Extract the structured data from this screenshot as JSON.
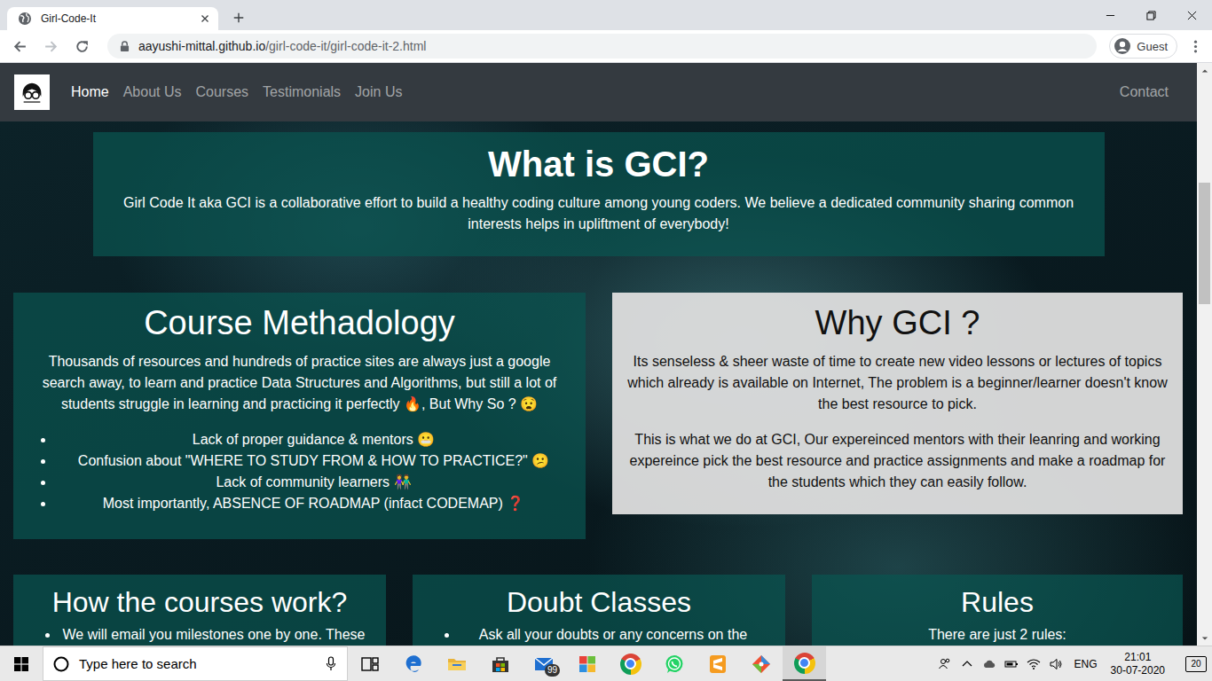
{
  "tabs": [
    {
      "label": "Girl-Code-It",
      "selected": true
    }
  ],
  "address_bar": {
    "host": "aayushi-mittal.github.io",
    "path": "/girl-code-it/girl-code-it-2.html"
  },
  "profile": {
    "label": "Guest"
  },
  "navbar": {
    "links": [
      {
        "label": "Home",
        "selected": true
      },
      {
        "label": "About Us",
        "selected": false
      },
      {
        "label": "Courses",
        "selected": false
      },
      {
        "label": "Testimonials",
        "selected": false
      },
      {
        "label": "Join Us",
        "selected": false
      }
    ],
    "right_link": {
      "label": "Contact",
      "selected": false
    }
  },
  "hero": {
    "title": "What is GCI?",
    "text": "Girl Code It aka GCI is a collaborative effort to build a healthy coding culture among young coders. We believe a dedicated community sharing common interests helps in upliftment of everybody!"
  },
  "methodology": {
    "title": "Course Methadology",
    "text": "Thousands of resources and hundreds of practice sites are always just a google search away, to learn and practice Data Structures and Algorithms, but still a lot of students struggle in learning and practicing it perfectly 🔥, But Why So ? 😧",
    "bullets": [
      "Lack of proper guidance & mentors 😬",
      "Confusion about \"WHERE TO STUDY FROM & HOW TO PRACTICE?\" 😕",
      "Lack of community learners 👫",
      "Most importantly, ABSENCE OF ROADMAP (infact CODEMAP) ❓"
    ]
  },
  "why": {
    "title": "Why GCI ?",
    "paragraphs": [
      "Its senseless & sheer waste of time to create new video lessons or lectures of topics which already is available on Internet, The problem is a beginner/learner doesn't know the best resource to pick.",
      "This is what we do at GCI, Our expereinced mentors with their leanring and working expereince pick the best resource and practice assignments and make a roadmap for the students which they can easily follow."
    ]
  },
  "cards": [
    {
      "title": "How the courses work?",
      "kind": "list",
      "lines": [
        "We will email you milestones one by one. These"
      ]
    },
    {
      "title": "Doubt Classes",
      "kind": "list",
      "lines": [
        "Ask all your doubts or any concerns on the"
      ]
    },
    {
      "title": "Rules",
      "kind": "text",
      "lines": [
        "There are just 2 rules:"
      ]
    }
  ],
  "scrollbar": {
    "thumb_start": 0.19,
    "thumb_size": 0.22
  },
  "taskbar": {
    "search_placeholder": "Type here to search",
    "apps": [
      {
        "kind": "taskview",
        "active": false,
        "badge": ""
      },
      {
        "kind": "edge",
        "active": false,
        "badge": ""
      },
      {
        "kind": "explorer",
        "active": false,
        "badge": ""
      },
      {
        "kind": "store",
        "active": false,
        "badge": ""
      },
      {
        "kind": "mail",
        "active": false,
        "badge": "99"
      },
      {
        "kind": "office",
        "active": false,
        "badge": ""
      },
      {
        "kind": "chrome",
        "active": false,
        "badge": ""
      },
      {
        "kind": "whatsapp",
        "active": false,
        "badge": ""
      },
      {
        "kind": "sublime",
        "active": false,
        "badge": ""
      },
      {
        "kind": "git",
        "active": false,
        "badge": ""
      },
      {
        "kind": "chrome",
        "active": true,
        "badge": ""
      }
    ],
    "tray": {
      "language": "ENG",
      "time": "21:01",
      "date": "30-07-2020",
      "notifications": "20"
    }
  }
}
